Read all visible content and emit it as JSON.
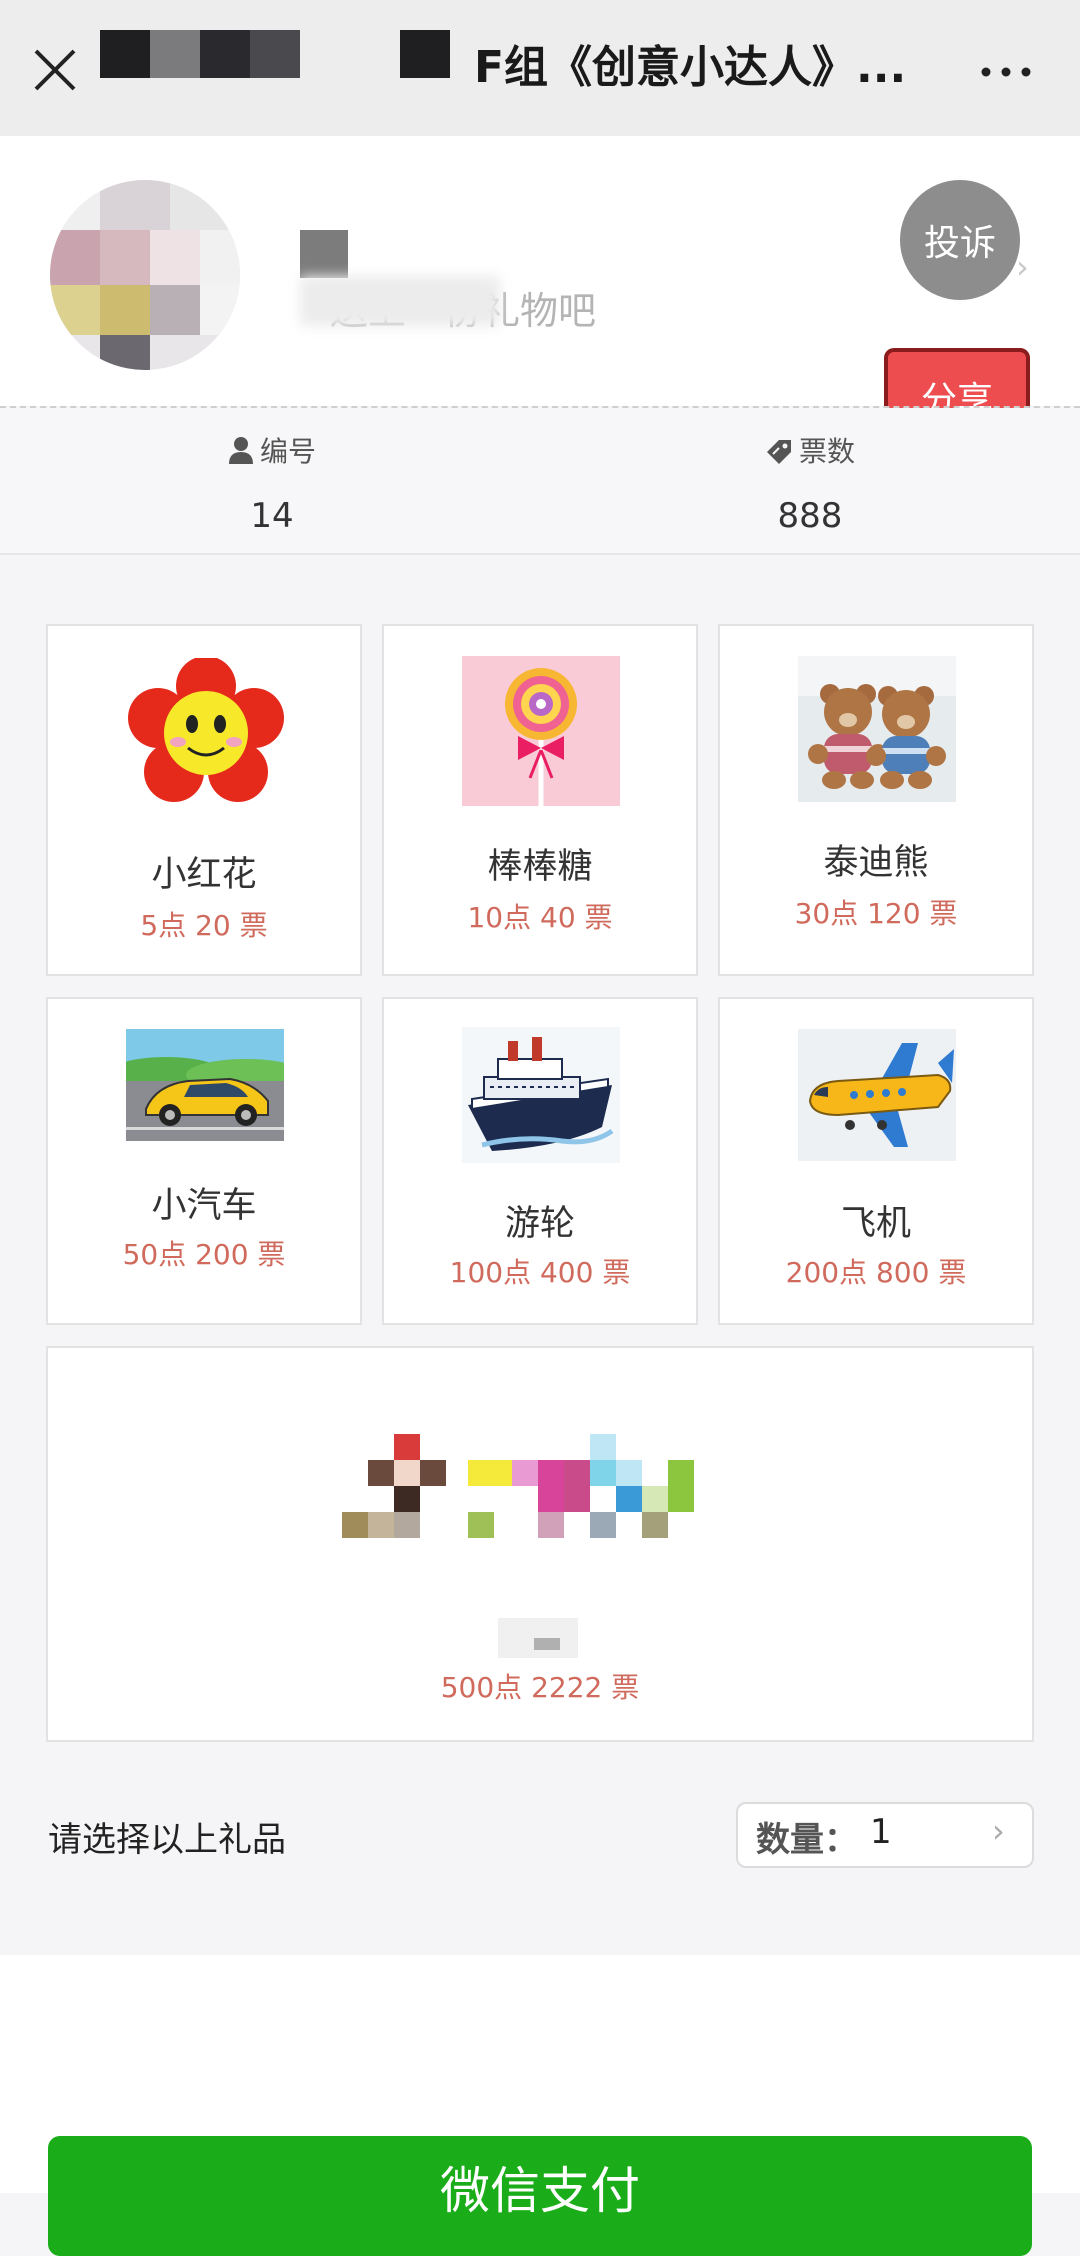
{
  "header": {
    "title": "F组《创意小达人》...",
    "close_icon": "close-icon",
    "more_icon": "more-icon"
  },
  "profile": {
    "greeting_text": "送上一份礼物吧",
    "report_label": "投诉",
    "share_label": "分享"
  },
  "stats": {
    "number_label": "编号",
    "number_value": "14",
    "votes_label": "票数",
    "votes_value": "888"
  },
  "gifts": [
    {
      "name": "小红花",
      "price": "5点 20 票"
    },
    {
      "name": "棒棒糖",
      "price": "10点 40 票"
    },
    {
      "name": "泰迪熊",
      "price": "30点 120 票"
    },
    {
      "name": "小汽车",
      "price": "50点 200 票"
    },
    {
      "name": "游轮",
      "price": "100点 400 票"
    },
    {
      "name": "飞机",
      "price": "200点 800 票"
    },
    {
      "name": "",
      "price": "500点 2222 票"
    }
  ],
  "selection": {
    "prompt": "请选择以上礼品",
    "qty_label": "数量：",
    "qty_value": "1"
  },
  "pay": {
    "label": "微信支付"
  },
  "colors": {
    "pay_green": "#1aad19",
    "share_red": "#ee4d4f",
    "price_red": "#d06a5c"
  }
}
